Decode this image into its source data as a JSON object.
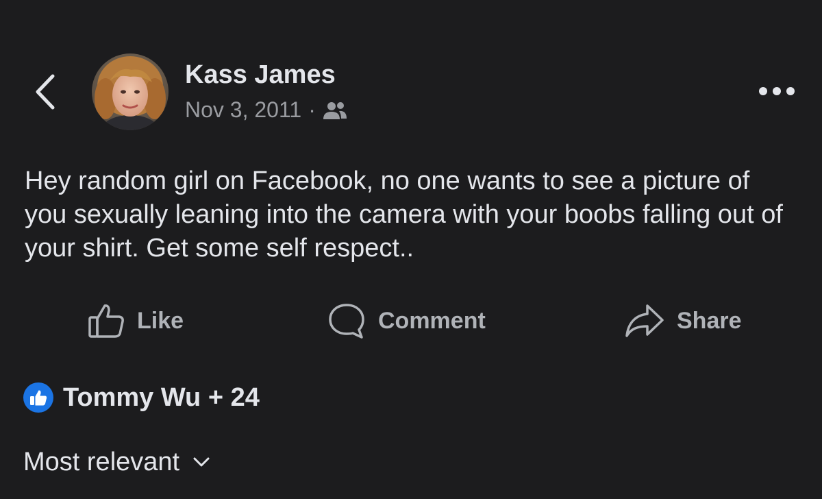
{
  "post": {
    "author": "Kass James",
    "date": "Nov 3, 2011",
    "separator": "·",
    "audience_icon": "friends-icon",
    "text": "Hey random girl on Facebook, no one wants to see a picture of you sexually leaning into the camera with your boobs falling out of your shirt. Get some self respect.."
  },
  "actions": {
    "like_label": "Like",
    "comment_label": "Comment",
    "share_label": "Share"
  },
  "reactions": {
    "summary": "Tommy Wu + 24",
    "icon": "thumbs-up-icon"
  },
  "comments": {
    "sort_label": "Most relevant"
  },
  "colors": {
    "background": "#1c1c1e",
    "text_primary": "#e4e6eb",
    "text_secondary": "#9a9ca1",
    "like_blue": "#1b74e4"
  }
}
